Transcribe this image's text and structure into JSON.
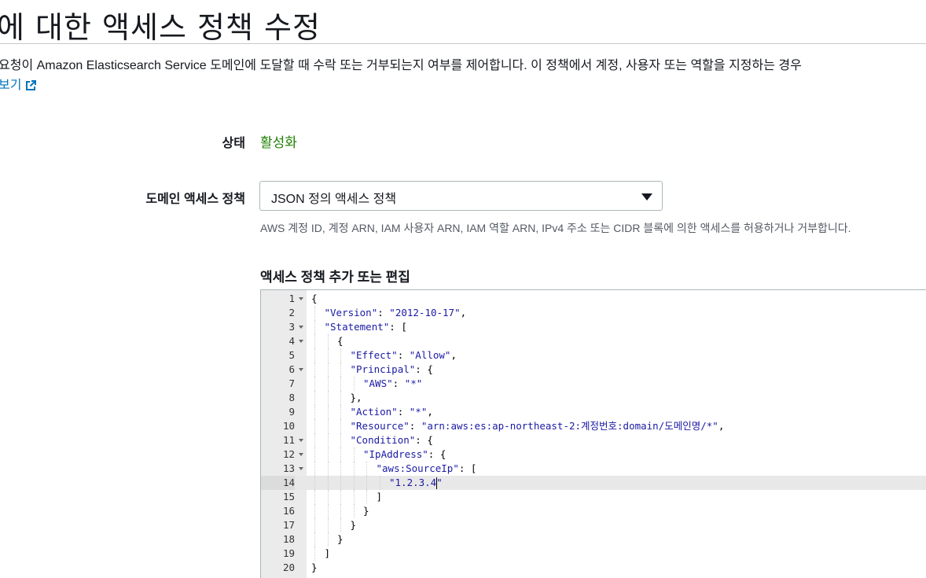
{
  "header": {
    "title": "에 대한 액세스 정책 수정",
    "description": "요청이 Amazon Elasticsearch Service 도메인에 도달할 때 수락 또는 거부되는지 여부를 제어합니다. 이 정책에서 계정, 사용자 또는 역할을 지정하는 경우",
    "learn_more": "보기"
  },
  "form": {
    "status_label": "상태",
    "status_value": "활성화",
    "policy_label": "도메인 액세스 정책",
    "policy_select": "JSON 정의 액세스 정책",
    "policy_hint": "AWS 계정 ID, 계정 ARN, IAM 사용자 ARN, IAM 역할 ARN, IPv4 주소 또는 CIDR 블록에 의한 액세스를 허용하거나 거부합니다.",
    "editor_heading": "액세스 정책 추가 또는 편집"
  },
  "colors": {
    "status_green": "#1d8102",
    "link_blue": "#0073bb",
    "code_string": "#1a1aa6"
  },
  "editor": {
    "active_line": 14,
    "lines": [
      {
        "num": "1",
        "fold": true,
        "indent": 0,
        "text": "{"
      },
      {
        "num": "2",
        "fold": false,
        "indent": 1,
        "text": "\"Version\": \"2012-10-17\","
      },
      {
        "num": "3",
        "fold": true,
        "indent": 1,
        "text": "\"Statement\": ["
      },
      {
        "num": "4",
        "fold": true,
        "indent": 2,
        "text": "{"
      },
      {
        "num": "5",
        "fold": false,
        "indent": 3,
        "text": "\"Effect\": \"Allow\","
      },
      {
        "num": "6",
        "fold": true,
        "indent": 3,
        "text": "\"Principal\": {"
      },
      {
        "num": "7",
        "fold": false,
        "indent": 4,
        "text": "\"AWS\": \"*\""
      },
      {
        "num": "8",
        "fold": false,
        "indent": 3,
        "text": "},"
      },
      {
        "num": "9",
        "fold": false,
        "indent": 3,
        "text": "\"Action\": \"*\","
      },
      {
        "num": "10",
        "fold": false,
        "indent": 3,
        "text": "\"Resource\": \"arn:aws:es:ap-northeast-2:계정번호:domain/도메인명/*\","
      },
      {
        "num": "11",
        "fold": true,
        "indent": 3,
        "text": "\"Condition\": {"
      },
      {
        "num": "12",
        "fold": true,
        "indent": 4,
        "text": "\"IpAddress\": {"
      },
      {
        "num": "13",
        "fold": true,
        "indent": 5,
        "text": "\"aws:SourceIp\": ["
      },
      {
        "num": "14",
        "fold": false,
        "indent": 6,
        "text": "\"1.2.3.4\""
      },
      {
        "num": "15",
        "fold": false,
        "indent": 5,
        "text": "]"
      },
      {
        "num": "16",
        "fold": false,
        "indent": 4,
        "text": "}"
      },
      {
        "num": "17",
        "fold": false,
        "indent": 3,
        "text": "}"
      },
      {
        "num": "18",
        "fold": false,
        "indent": 2,
        "text": "}"
      },
      {
        "num": "19",
        "fold": false,
        "indent": 1,
        "text": "]"
      },
      {
        "num": "20",
        "fold": false,
        "indent": 0,
        "text": "}"
      }
    ]
  }
}
